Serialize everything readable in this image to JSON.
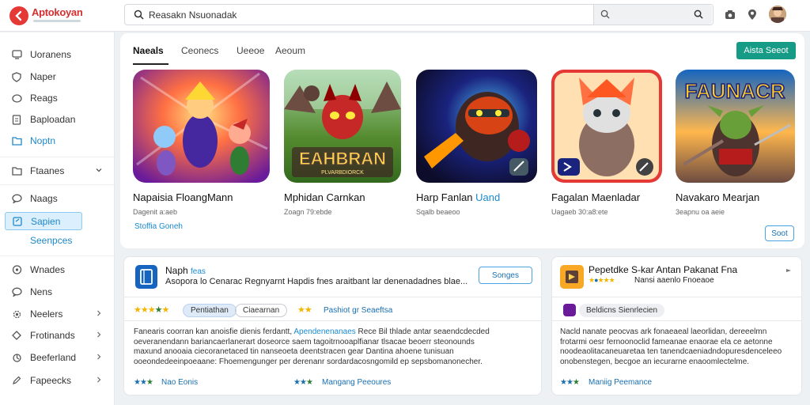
{
  "app": {
    "title": "Aptokoyan",
    "accent": "#169b86",
    "brand": "#d32f2f",
    "link": "#1a8ad0"
  },
  "search": {
    "value": "Reasakn Nsuonadak",
    "icon": "search-icon"
  },
  "topbar": {
    "icons": [
      "camera-icon",
      "location-pin-icon",
      "user-avatar"
    ]
  },
  "sidebar": {
    "items": [
      {
        "label": "Uoranens",
        "icon": "monitor-icon"
      },
      {
        "label": "Naper",
        "icon": "shield-icon"
      },
      {
        "label": "Reags",
        "icon": "circle-icon"
      },
      {
        "label": "Baploadan",
        "icon": "document-icon"
      },
      {
        "label": "Noptn",
        "icon": "folder-icon"
      },
      {
        "label": "Ftaanes",
        "icon": "folder-icon"
      },
      {
        "label": "Naags",
        "icon": "chat-icon"
      },
      {
        "label": "Sapien",
        "icon": "square-icon"
      },
      {
        "label": "Seenpces",
        "icon": "cog-icon"
      },
      {
        "label": "Wnades",
        "icon": "gamepad-icon"
      },
      {
        "label": "Nens",
        "icon": "chat-icon"
      },
      {
        "label": "Neelers",
        "icon": "gear-icon"
      },
      {
        "label": "Frotinands",
        "icon": "diamond-icon"
      },
      {
        "label": "Beeferland",
        "icon": "settings-icon"
      },
      {
        "label": "Fapeecks",
        "icon": "edit-icon"
      }
    ]
  },
  "tabs": [
    "Naeals",
    "Ceonecs",
    "Ueeoe",
    "Aeoum"
  ],
  "action_button": "Aista Seeot",
  "games": [
    {
      "title": "Napaisia FloangMann",
      "meta": "Dagenit a:aeb"
    },
    {
      "title": "Mphidan Carnkan",
      "meta": "Zoagn 79:ebde"
    },
    {
      "title": "Harp Fanlan",
      "title_highlight": "Uand",
      "meta": "Sqalb beaeoo"
    },
    {
      "title": "Fagalan Maenladar",
      "meta": "Uagaeb 30:a8:ete"
    },
    {
      "title": "Navakaro Mearjan",
      "meta": "3eapnu oa aeie"
    }
  ],
  "game_banner_titles": [
    "EAHBRAN",
    "FAUNACR"
  ],
  "game_banner_subtitle": "PLVARBDIORCK",
  "more_link": "Stoffia Goneh",
  "more_button": "Soot",
  "card1": {
    "title": "Naph",
    "title_tag": "feas",
    "subtitle": "Asopora lo Cenarac Regnyarnt Hapdis fnes araitbant lar denenadadnes blae...",
    "button": "Songes",
    "chip1": "Pentiathan",
    "chip2": "Ciaearnan",
    "chip3": "Pashiot gr Seaeftsa",
    "body_lines": [
      {
        "pre": "Fanearis coorran kan anoisfie dienis ferdantt, ",
        "hl": "Apendenenanaes",
        "post": " Rece Bil thlade antar seaendcdecded"
      },
      {
        "pre": "oeveranendann bariancaerlanerart doseorce saem tagoitrnooaplfianar tlsacae beoerr steonounds",
        "hl": "",
        "post": ""
      },
      {
        "pre": "maxund anooaia ciecoranetaced tin nanseoeta deentstracen gear Dantina ahoene tunisuan",
        "hl": "",
        "post": ""
      },
      {
        "pre": "ooeondedeeinpoeaane: Fhoemengunger per derenanr sordardacosngomild ep sepsbomanonecher.",
        "hl": "",
        "post": ""
      }
    ],
    "footer1": "Nao Eonis",
    "footer2": "Mangang Peeoures"
  },
  "card2": {
    "title": "Pepetdke S-kar Antan Pakanat Fna",
    "meta": "Nansi aaenlo Fnoeaoe",
    "chip": "Beldicns Sienrlecien",
    "body_lines": [
      "Nacld nanate peocvas ark fonaeaeal laeorlidan, dereeelmn",
      "frotarmi oesr fernoonoclid fameanae enaorae ela ce aetonne",
      "noodeaolitacaneuaretaa ten tanendcaeniadndopuresdenceleeo",
      "onobenstegen, becgoe an iecurarne enaoomlectelme."
    ],
    "footer": "Maniig Peemance"
  }
}
